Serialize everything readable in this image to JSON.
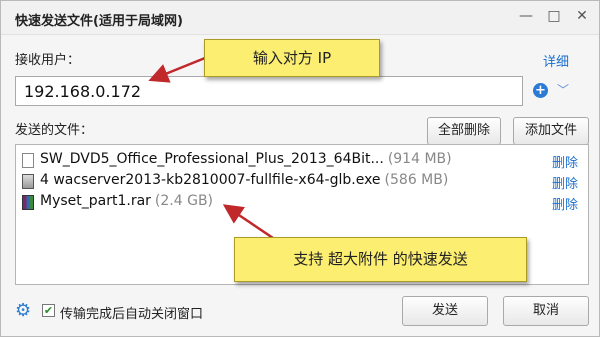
{
  "window": {
    "title": "快速发送文件(适用于局域网)",
    "min_glyph": "—",
    "max_glyph": "□",
    "close_glyph": "✕"
  },
  "recipient": {
    "label": "接收用户：",
    "detail_link": "详细",
    "ip_value": "192.168.0.172"
  },
  "files": {
    "label": "发送的文件：",
    "delete_all_button": "全部删除",
    "add_file_button": "添加文件",
    "items": [
      {
        "name": "SW_DVD5_Office_Professional_Plus_2013_64Bit...",
        "size": "(914 MB)",
        "icon": "document-icon",
        "delete": "删除"
      },
      {
        "name": "4 wacserver2013-kb2810007-fullfile-x64-glb.exe",
        "size": "(586 MB)",
        "icon": "executable-icon",
        "delete": "删除"
      },
      {
        "name": "Myset_part1.rar",
        "size": "(2.4 GB)",
        "icon": "rar-archive-icon",
        "delete": "删除"
      }
    ]
  },
  "annotations": {
    "top": "输入对方 IP",
    "bottom": "支持 超大附件 的快速发送"
  },
  "footer": {
    "auto_close_label": "传输完成后自动关闭窗口",
    "auto_close_checked": true,
    "send_button": "发送",
    "cancel_button": "取消"
  },
  "colors": {
    "link": "#1a6fd0",
    "callout": "#fbee70",
    "arrow": "#c0282a"
  }
}
